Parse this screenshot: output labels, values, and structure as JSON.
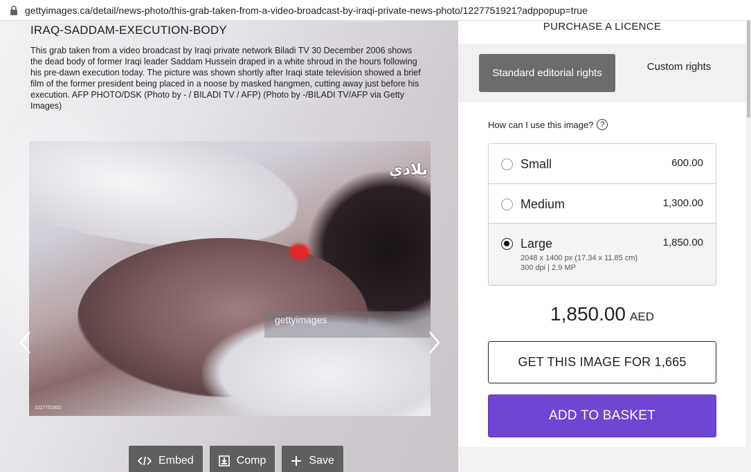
{
  "browser": {
    "url": "gettyimages.ca/detail/news-photo/this-grab-taken-from-a-video-broadcast-by-iraqi-private-news-photo/1227751921?adppopup=true"
  },
  "image": {
    "title": "IRAQ-SADDAM-EXECUTION-BODY",
    "caption": "This grab taken from a video broadcast by Iraqi private network Biladi TV 30 December 2006 shows the dead body of former Iraqi leader Saddam Hussein draped in a white shroud in the hours following his pre-dawn execution today. The picture was shown shortly after Iraqi state television showed a brief film of the former president being placed in a noose by masked hangmen, cutting away just before his execution. AFP PHOTO/DSK (Photo by - / BILADI TV / AFP) (Photo by -/BILADI TV/AFP via Getty Images)",
    "watermark": "gettyimages",
    "overlay_text": "بلادي",
    "image_id": "1227751921"
  },
  "tools": {
    "embed": "Embed",
    "comp": "Comp",
    "save": "Save"
  },
  "panel": {
    "purchase_heading": "PURCHASE A LICENCE",
    "tab_standard": "Standard editorial rights",
    "tab_custom": "Custom rights",
    "question": "How can I use this image?",
    "sizes": [
      {
        "label": "Small",
        "price": "600.00",
        "detail1": "",
        "detail2": "",
        "selected": false
      },
      {
        "label": "Medium",
        "price": "1,300.00",
        "detail1": "",
        "detail2": "",
        "selected": false
      },
      {
        "label": "Large",
        "price": "1,850.00",
        "detail1": "2048 x 1400 px (17.34 x 11.85 cm)",
        "detail2": "300 dpi | 2.9 MP",
        "selected": true
      }
    ],
    "total_amount": "1,850.00",
    "currency": "AED",
    "get_button": "GET THIS IMAGE FOR 1,665",
    "basket_button": "ADD TO BASKET"
  },
  "colors": {
    "accent": "#6f45d4",
    "tab_active": "#6c6c6c",
    "tool_button": "#5f5f5f"
  }
}
